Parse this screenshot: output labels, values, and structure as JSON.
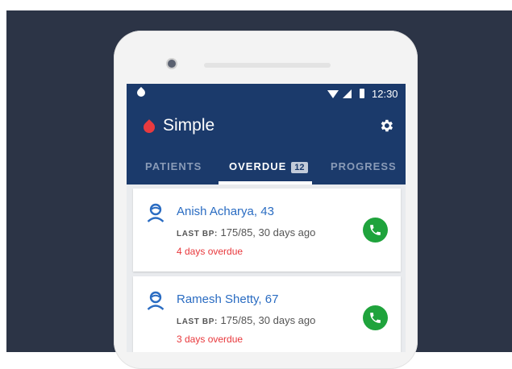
{
  "status_bar": {
    "time": "12:30"
  },
  "app_bar": {
    "title": "Simple"
  },
  "tabs": [
    {
      "label": "PATIENTS"
    },
    {
      "label": "OVERDUE",
      "badge": "12"
    },
    {
      "label": "PROGRESS"
    }
  ],
  "patients": [
    {
      "name": "Anish Acharya, 43",
      "last_bp_label": "LAST BP:",
      "last_bp_value": "175/85, 30 days ago",
      "overdue": "4 days overdue"
    },
    {
      "name": "Ramesh Shetty, 67",
      "last_bp_label": "LAST BP:",
      "last_bp_value": "175/85, 30 days ago",
      "overdue": "3 days overdue"
    }
  ],
  "icons": {
    "app_logo": "blood-drop-icon",
    "settings": "gear-icon",
    "patient": "person-icon",
    "call": "phone-icon"
  },
  "colors": {
    "header": "#1b3a6b",
    "accent_blue": "#2a6cc2",
    "overdue_red": "#e8383c",
    "call_green": "#1fa33c",
    "logo_red": "#e83a3f",
    "background": "#2c3446"
  }
}
